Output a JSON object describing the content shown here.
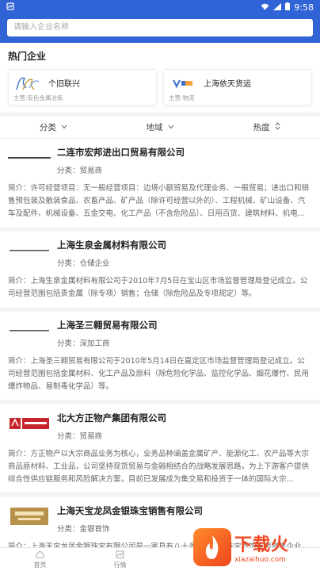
{
  "status": {
    "time": "9:58"
  },
  "search": {
    "placeholder": "请输入企业名称"
  },
  "hot": {
    "title": "热门企业",
    "cards": [
      {
        "name": "个旧联兴",
        "sub": "主营:有色金属冶炼"
      },
      {
        "name": "上海依天货运",
        "sub": "主营:物流"
      }
    ]
  },
  "filters": {
    "category": "分类",
    "region": "地域",
    "popularity": "热度"
  },
  "companies": [
    {
      "name": "二连市宏邦进出口贸易有限公司",
      "category": "分类：贸易商",
      "desc": "简介：许可经营项目：无一般经营项目：边境小额贸易及代理业务、一般贸易；进出口和销售预包装及散装食品、农畜产品、矿产品（除许可经营以外的）、工程机械、矿山设备、汽车及配件、机械设备、五金交电、化工产品（不含危险品）、日用百货、建筑材料、机电..."
    },
    {
      "name": "上海生泉金属材料有限公司",
      "category": "分类：仓储企业",
      "desc": "简介：上海生泉金属材料有限公司于2010年7月5日在宝山区市场监督管理局登记成立。公司经营范围包括贵金属（除专项）销售；仓储（除危险品及专项规定）等。"
    },
    {
      "name": "上海圣三翱贸易有限公司",
      "category": "分类：深加工商",
      "desc": "简介：上海圣三翱贸易有限公司于2010年5月14日在嘉定区市场监督管理局登记成立。公司经营范围包括金属材料、化工产品及原料（除危险化学品、监控化学品、烟花爆竹、民用爆炸物品、易制毒化学品）等。"
    },
    {
      "name": "北大方正物产集团有限公司",
      "category": "分类：贸易商",
      "desc": "简介：方正物产以大宗商品业务为核心，业务品种涵盖金属矿产、能源化工、农产品等大宗商品原材料、工业品，公司坚持现货贸易与金融相结合的战略发展思路，为上下游客户提供综合性供应链服务和风险解决方案，目前已发展成为集交易和投资于一体的国际大宗..."
    },
    {
      "name": "上海天宝龙凤金银珠宝销售有限公司",
      "category": "分类：金银首饰",
      "desc": "简介：上海天宝龙凤金银珠宝有限公司是一家具有八十多年历史的珠宝首饰连锁销售企业，公司以“诚信服务、顾客至尊、品位生活、美化人生”为服务理念，在经济变革的环境下秉承传统的基础上，紧跟国际时尚潮流，以独特设计理念打造..."
    }
  ],
  "tabs": {
    "home": "首页",
    "news": "行情"
  },
  "watermark": {
    "cn": "下载火",
    "en": "xiazaihuo.com"
  },
  "colors": {
    "brand": "#2f63d6",
    "watermark": "#f0451f"
  }
}
